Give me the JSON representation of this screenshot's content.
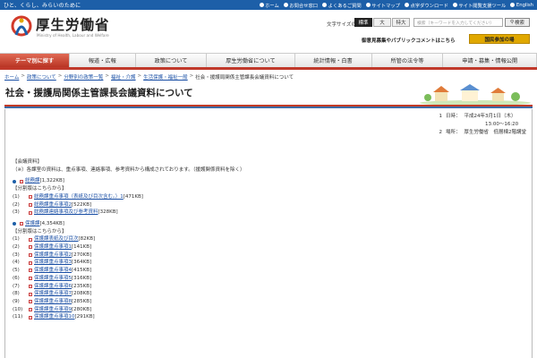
{
  "topbar": {
    "tagline": "ひと、くらし、みらいのために",
    "links": [
      "ホーム",
      "お問合せ窓口",
      "よくあるご質問",
      "サイトマップ",
      "点字ダウンロード",
      "サイト閲覧支援ツール",
      "English"
    ]
  },
  "header": {
    "title": "厚生労働省",
    "subtitle": "Ministry of Health, Labour and Welfare",
    "font_size_label": "文字サイズの変更",
    "font_sizes": [
      "標準",
      "大",
      "特大"
    ],
    "search_placeholder": "検索（キーワードを入力してください）",
    "search_button": "検索",
    "opinion_link": "御意見募集やパブリックコメントはこちら",
    "kokumin_button": "国民参加の場"
  },
  "gnav": [
    "テーマ別に探す",
    "報道・広報",
    "政策について",
    "厚生労働省について",
    "統計情報・白書",
    "所管の法令等",
    "申請・募集・情報公開"
  ],
  "breadcrumb": {
    "links": [
      "ホーム",
      "政策について",
      "分野別の政策一覧",
      "福祉・介護",
      "生活保護・福祉一般"
    ],
    "current": "社会・援護局関係主管課長会議資料について"
  },
  "page_title": "社会・援護局関係主管課長会議資料について",
  "meta": {
    "date_num": "1",
    "date_label": "日時：",
    "date_value": "平成24年3月1日（木）",
    "time_value": "13:00～16:20",
    "place_num": "2",
    "place_label": "場所：",
    "place_value": "厚生労働省　低層棟2階講堂"
  },
  "body": {
    "section_label": "【会議資料】",
    "note": "（※）各課室の資料は、重点事項、連絡事項、参考資料から構成されております。（援護関係資料を除く）",
    "somuka": {
      "link": "総務課",
      "size": "[1,322KB]"
    },
    "split_label": "【分割版はこちらから】",
    "somuka_items": [
      {
        "idx": "(1)",
        "link": "総務課重点事項（表紙及び目次含む。）1",
        "size": "[471KB]"
      },
      {
        "idx": "(2)",
        "link": "総務課重点事項2",
        "size": "[522KB]"
      },
      {
        "idx": "(3)",
        "link": "総務課連絡事項及び参考資料",
        "size": "[328KB]"
      }
    ],
    "hogoka": {
      "link": "保護課",
      "size": "[4,354KB]"
    },
    "split_label2": "【分割版はこちらから】",
    "hogoka_items": [
      {
        "idx": "(1)",
        "link": "保護課表紙及び目次",
        "size": "[82KB]"
      },
      {
        "idx": "(2)",
        "link": "保護課重点事項1",
        "size": "[141KB]"
      },
      {
        "idx": "(3)",
        "link": "保護課重点事項2",
        "size": "[270KB]"
      },
      {
        "idx": "(4)",
        "link": "保護課重点事項3",
        "size": "[364KB]"
      },
      {
        "idx": "(5)",
        "link": "保護課重点事項4",
        "size": "[415KB]"
      },
      {
        "idx": "(6)",
        "link": "保護課重点事項5",
        "size": "[316KB]"
      },
      {
        "idx": "(7)",
        "link": "保護課重点事項6",
        "size": "[235KB]"
      },
      {
        "idx": "(8)",
        "link": "保護課重点事項7",
        "size": "[208KB]"
      },
      {
        "idx": "(9)",
        "link": "保護課重点事項8",
        "size": "[285KB]"
      },
      {
        "idx": "(10)",
        "link": "保護課重点事項9",
        "size": "[280KB]"
      },
      {
        "idx": "(11)",
        "link": "保護課重点事項10",
        "size": "[291KB]"
      }
    ]
  },
  "colors": {
    "topbar": "#1d5fa8",
    "accent_red": "#c0392b",
    "link": "#1a4fa5",
    "kokumin": "#e0a800"
  }
}
